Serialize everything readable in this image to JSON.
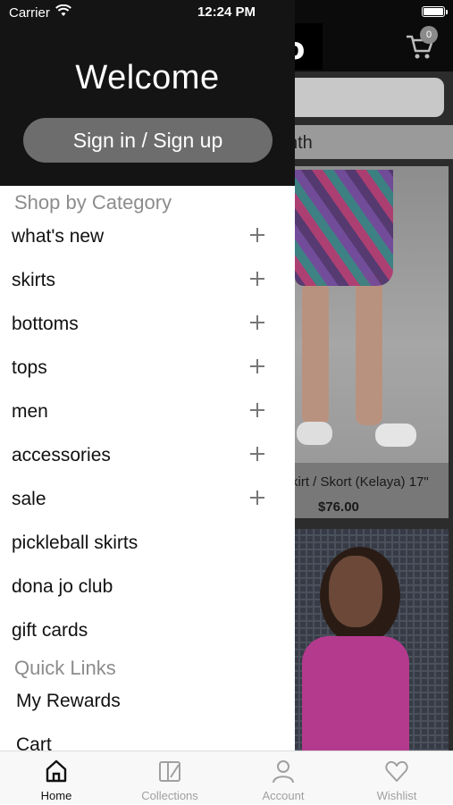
{
  "status_bar": {
    "carrier": "Carrier",
    "time": "12:24 PM"
  },
  "background": {
    "cart_count": "0",
    "subbar_text": "nth",
    "product": {
      "name": "kirt / Skort (Kelaya) 17\"",
      "price": "$76.00"
    }
  },
  "drawer": {
    "welcome": "Welcome",
    "signin_label": "Sign in / Sign up",
    "shop_by_category_title": "Shop by Category",
    "categories": [
      {
        "label": "what's new",
        "expandable": true
      },
      {
        "label": "skirts",
        "expandable": true
      },
      {
        "label": "bottoms",
        "expandable": true
      },
      {
        "label": "tops",
        "expandable": true
      },
      {
        "label": "men",
        "expandable": true
      },
      {
        "label": "accessories",
        "expandable": true
      },
      {
        "label": "sale",
        "expandable": true
      },
      {
        "label": "pickleball skirts",
        "expandable": false
      },
      {
        "label": "dona jo club",
        "expandable": false
      },
      {
        "label": "gift cards",
        "expandable": false
      }
    ],
    "quick_links_title": "Quick Links",
    "quick_links": [
      {
        "label": "My Rewards"
      },
      {
        "label": "Cart"
      }
    ]
  },
  "tabbar": {
    "tabs": [
      {
        "label": "Home",
        "icon": "home-icon",
        "active": true
      },
      {
        "label": "Collections",
        "icon": "collections-icon",
        "active": false
      },
      {
        "label": "Account",
        "icon": "account-icon",
        "active": false
      },
      {
        "label": "Wishlist",
        "icon": "heart-icon",
        "active": false
      }
    ]
  },
  "colors": {
    "drawer_header": "#141414",
    "signin_button": "#6d6d6d",
    "section_title": "#8c8c8c",
    "tab_inactive": "#a0a0a0"
  }
}
